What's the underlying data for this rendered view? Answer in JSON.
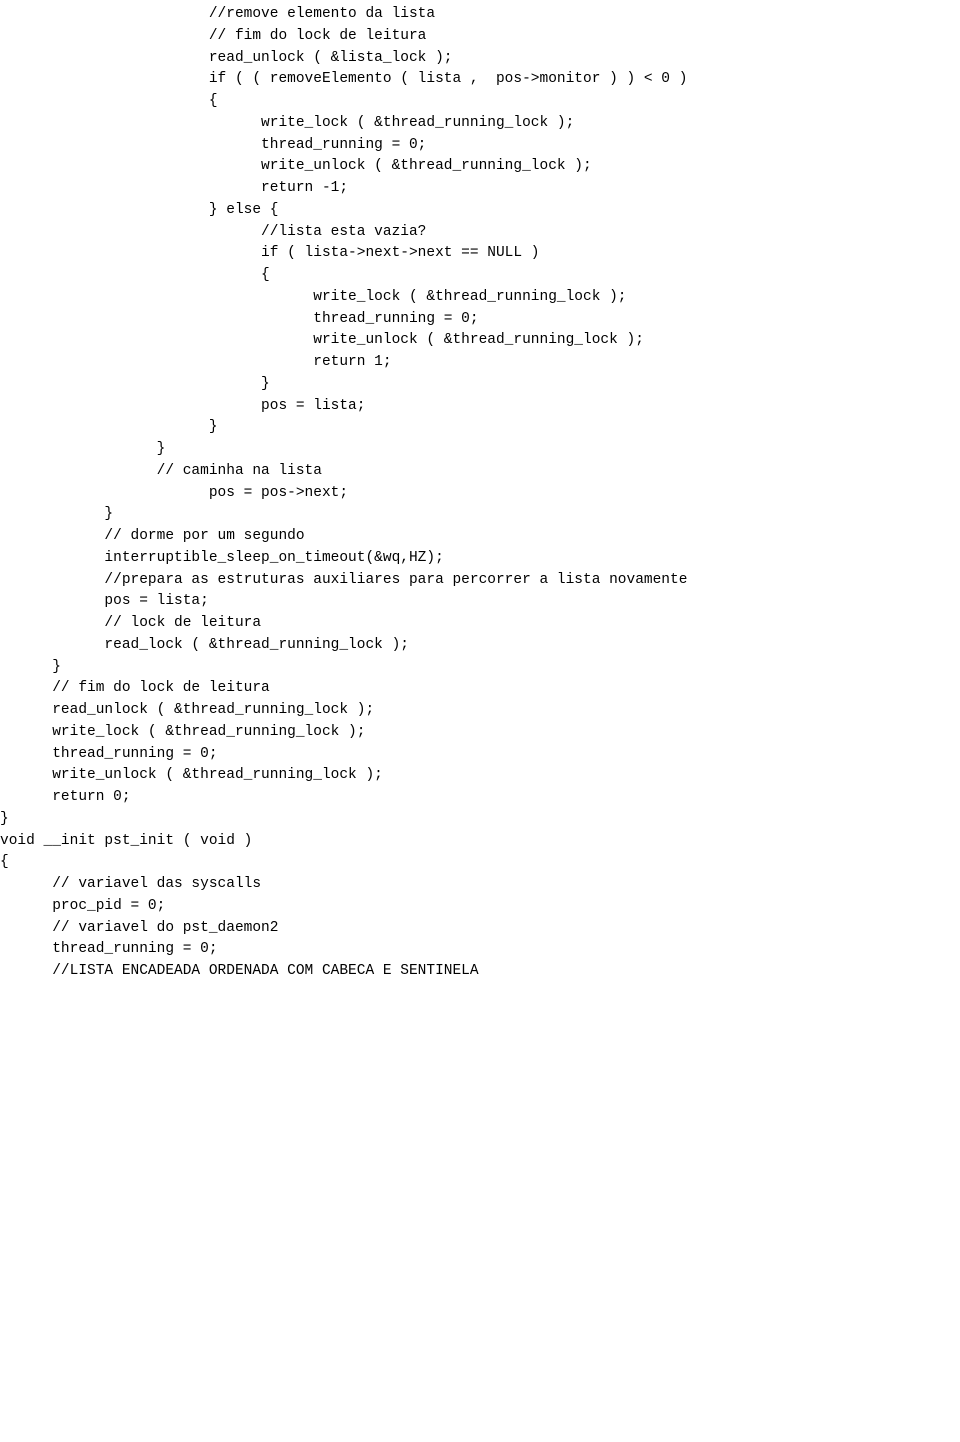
{
  "code_lines": [
    "                        //remove elemento da lista",
    "",
    "                        // fim do lock de leitura",
    "                        read_unlock ( &lista_lock );",
    "",
    "                        if ( ( removeElemento ( lista ,  pos->monitor ) ) < 0 )",
    "                        {",
    "",
    "                              write_lock ( &thread_running_lock );",
    "                              thread_running = 0;",
    "                              write_unlock ( &thread_running_lock );",
    "",
    "                              return -1;",
    "                        } else {",
    "                              //lista esta vazia?",
    "                              if ( lista->next->next == NULL )",
    "                              {",
    "",
    "                                    write_lock ( &thread_running_lock );",
    "                                    thread_running = 0;",
    "                                    write_unlock ( &thread_running_lock );",
    "",
    "                                    return 1;",
    "                              }",
    "                              pos = lista;",
    "                        }",
    "                  }",
    "",
    "                  // caminha na lista",
    "                        pos = pos->next;",
    "            }",
    "",
    "            // dorme por um segundo",
    "            interruptible_sleep_on_timeout(&wq,HZ);",
    "",
    "            //prepara as estruturas auxiliares para percorrer a lista novamente",
    "            pos = lista;",
    "",
    "            // lock de leitura",
    "            read_lock ( &thread_running_lock );",
    "      }",
    "",
    "      // fim do lock de leitura",
    "      read_unlock ( &thread_running_lock );",
    "",
    "",
    "      write_lock ( &thread_running_lock );",
    "      thread_running = 0;",
    "      write_unlock ( &thread_running_lock );",
    "",
    "      return 0;",
    "}",
    "",
    "",
    "",
    "void __init pst_init ( void )",
    "{",
    "      // variavel das syscalls",
    "      proc_pid = 0;",
    "",
    "      // variavel do pst_daemon2",
    "      thread_running = 0;",
    "",
    "      //LISTA ENCADEADA ORDENADA COM CABECA E SENTINELA"
  ]
}
